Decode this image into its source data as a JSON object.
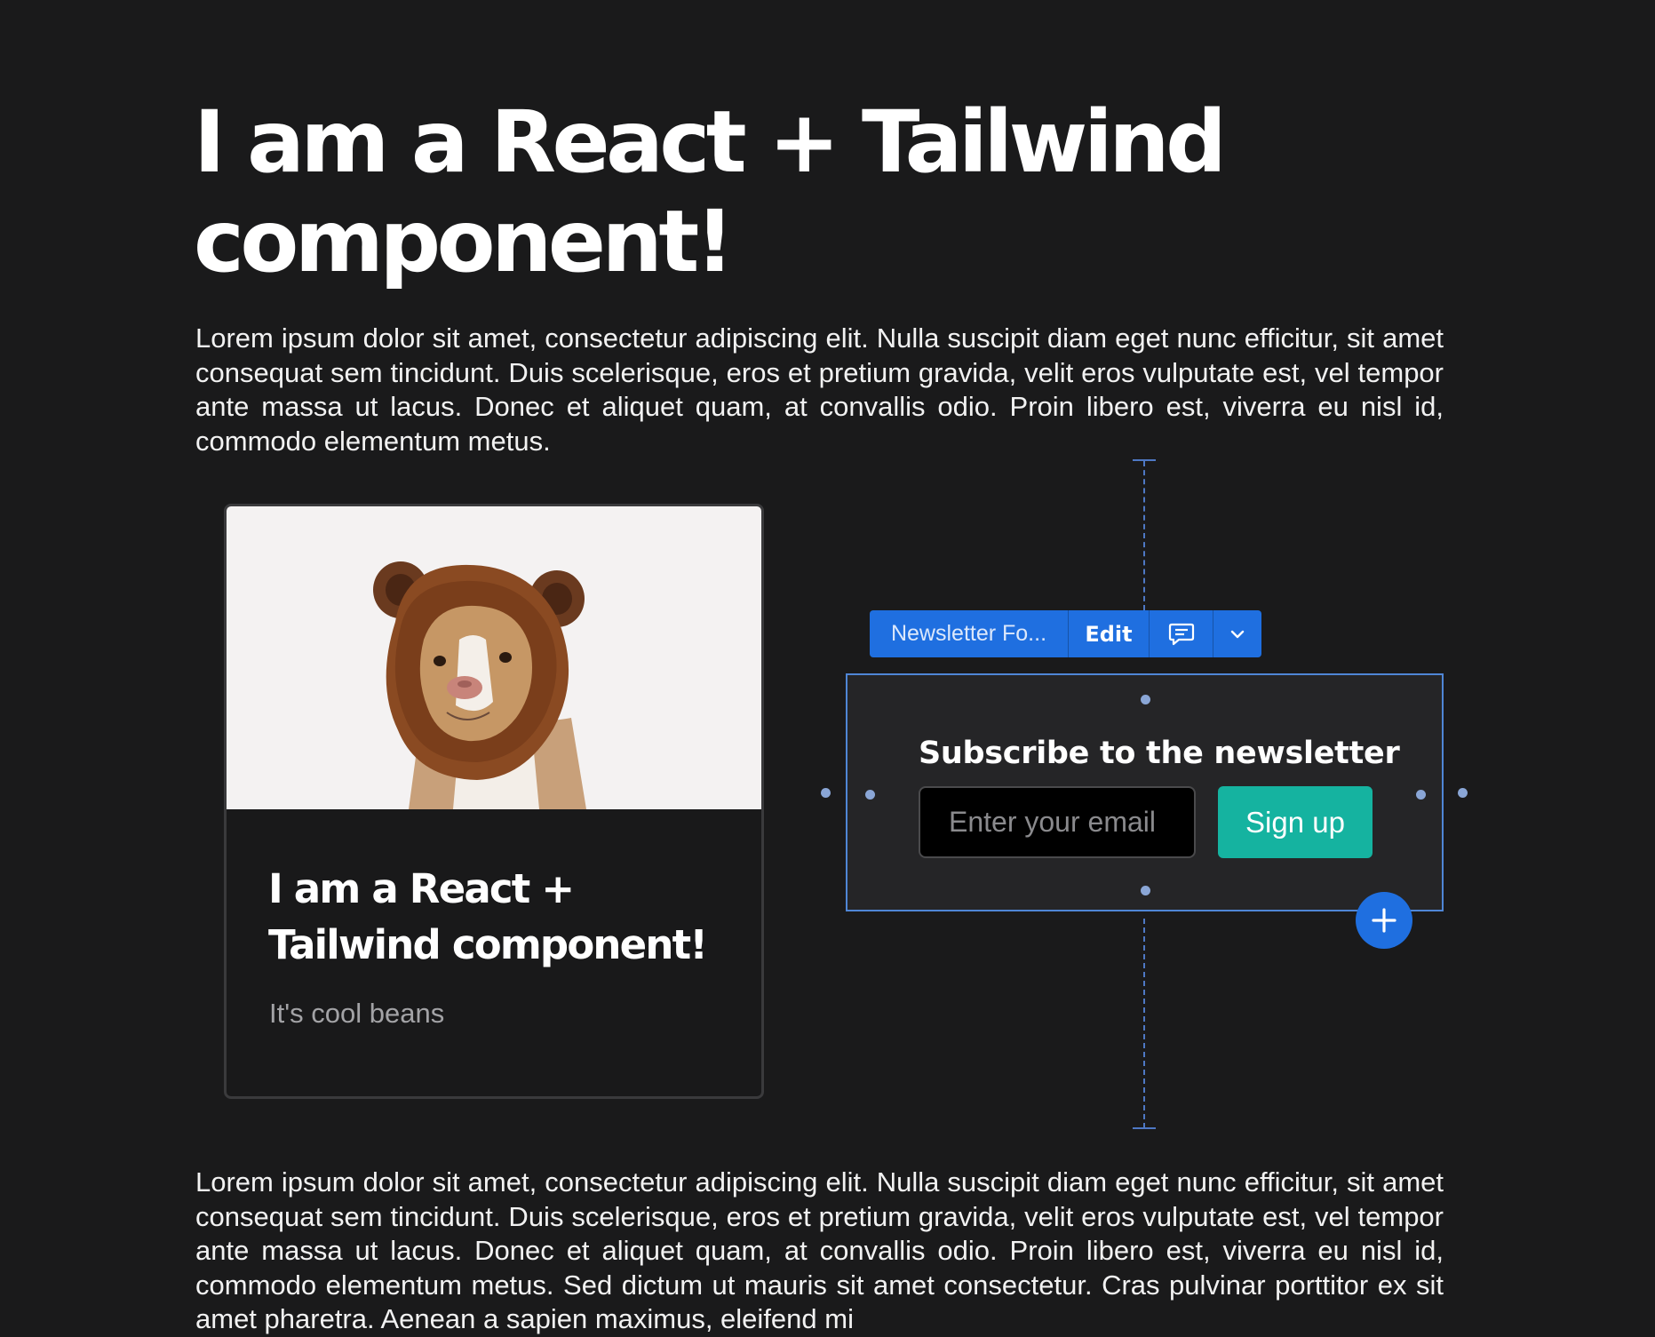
{
  "page": {
    "title": "I am a React + Tailwind component!",
    "intro": "Lorem ipsum dolor sit amet, consectetur adipiscing elit. Nulla suscipit diam eget nunc efficitur, sit amet consequat sem tincidunt. Duis scelerisque, eros et pretium gravida, velit eros vulputate est, vel tempor ante massa ut lacus. Donec et aliquet quam, at convallis odio. Proin libero est, viverra eu nisl id, commodo elementum metus.",
    "footer": "Lorem ipsum dolor sit amet, consectetur adipiscing elit. Nulla suscipit diam eget nunc efficitur, sit amet consequat sem tincidunt. Duis scelerisque, eros et pretium gravida, velit eros vulputate est, vel tempor ante massa ut lacus. Donec et aliquet quam, at convallis odio. Proin libero est, viverra eu nisl id, commodo elementum metus. Sed dictum ut mauris sit amet consectetur. Cras pulvinar porttitor ex sit amet pharetra. Aenean a sapien maximus, eleifend mi"
  },
  "card": {
    "title": "I am a React + Tailwind component!",
    "subtitle": "It's cool beans",
    "image_icon": "dog-in-bear-hat-photo"
  },
  "toolbar": {
    "component_name": "Newsletter Fo...",
    "edit_label": "Edit",
    "comment_icon": "comment-icon",
    "chevron_icon": "chevron-down-icon"
  },
  "newsletter": {
    "heading": "Subscribe to the newsletter",
    "email_placeholder": "Enter your email",
    "email_value": "",
    "button_label": "Sign up"
  },
  "add_button": {
    "icon": "plus-icon"
  },
  "colors": {
    "background": "#1a1a1b",
    "accent": "#1f6fe0",
    "signup_button": "#15b3a0",
    "selection_outline": "#4f86d6"
  }
}
